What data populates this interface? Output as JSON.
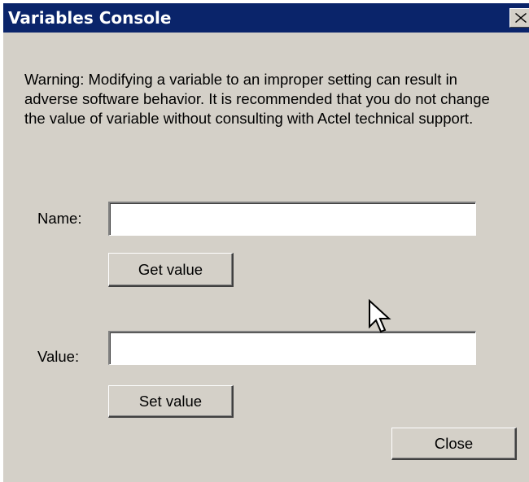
{
  "window": {
    "title": "Variables Console"
  },
  "warning_text": "Warning: Modifying a variable to an improper setting can result in adverse software behavior.  It is recommended that you do not change the value of variable without consulting with Actel technical support.",
  "name_field": {
    "label": "Name:",
    "value": "",
    "placeholder": ""
  },
  "get_button": {
    "label": "Get value"
  },
  "value_field": {
    "label": "Value:",
    "value": "",
    "placeholder": ""
  },
  "set_button": {
    "label": "Set value"
  },
  "close_button": {
    "label": "Close"
  },
  "icons": {
    "title_close": "close-icon",
    "pointer": "mouse-pointer-icon"
  },
  "colors": {
    "titlebar": "#0a246a",
    "face": "#d4d0c8"
  }
}
